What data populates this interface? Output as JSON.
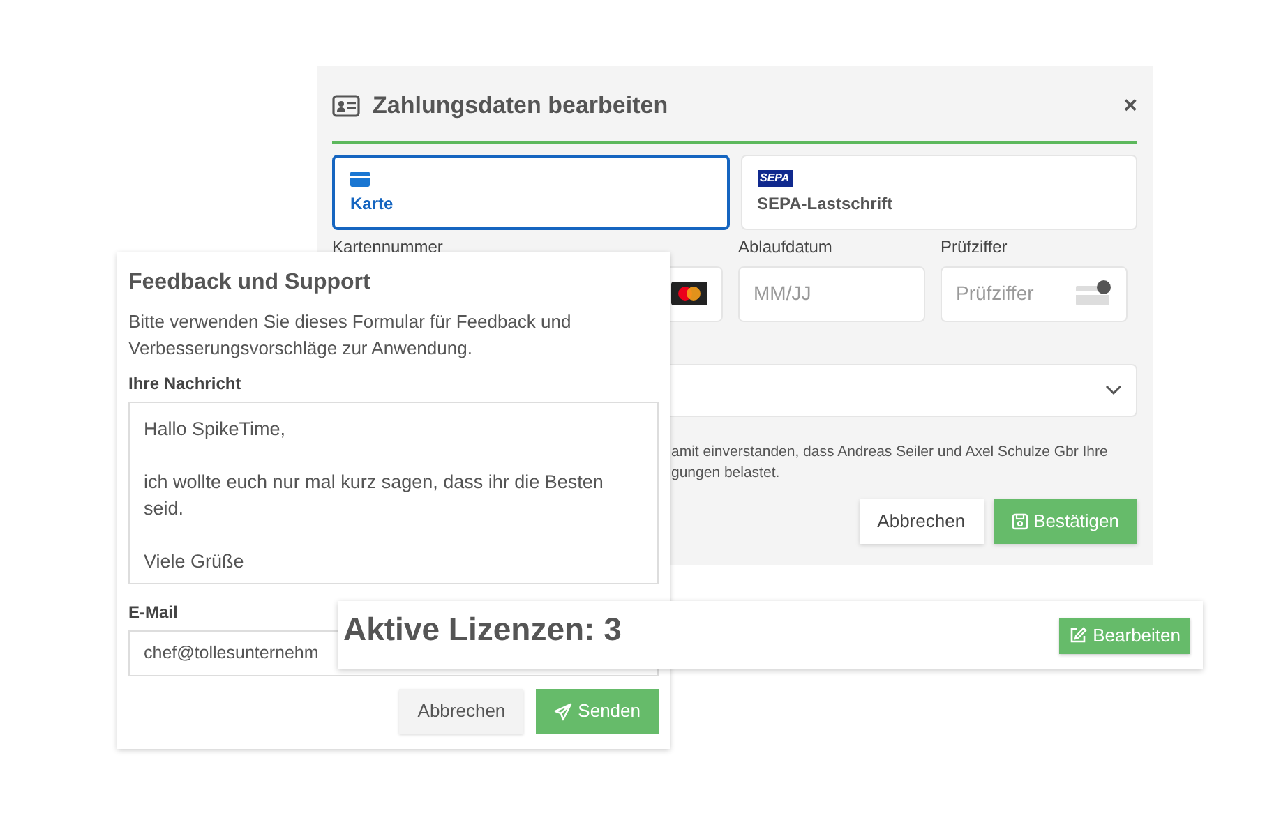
{
  "payment_dialog": {
    "title": "Zahlungsdaten bearbeiten",
    "close": "×",
    "methods": [
      {
        "label": "Karte",
        "kind": "card",
        "selected": true
      },
      {
        "label": "SEPA-Lastschrift",
        "kind": "sepa",
        "logo": "SEPA",
        "selected": false
      }
    ],
    "fields": [
      {
        "label": "Kartennummer",
        "kind": "card_number"
      },
      {
        "label": "Ablaufdatum",
        "placeholder": "MM/JJ",
        "kind": "text"
      },
      {
        "label": "Prüfziffer",
        "placeholder": "Prüfziffer",
        "kind": "cvc"
      }
    ],
    "mandate_text": [
      "amit einverstanden, dass Andreas Seiler und Axel Schulze Gbr Ihre",
      "gungen belastet."
    ],
    "buttons": [
      {
        "label": "Abbrechen",
        "kind": "secondary"
      },
      {
        "label": "Bestätigen",
        "kind": "primary"
      }
    ]
  },
  "feedback_card": {
    "title": "Feedback und Support",
    "description": "Bitte verwenden Sie dieses Formular für Feedback und Verbesserungsvorschläge zur Anwendung.",
    "message_label": "Ihre Nachricht",
    "message_paragraphs": [
      "Hallo SpikeTime,",
      "ich wollte euch nur mal kurz sagen, dass ihr die Besten seid.",
      "Viele Grüße"
    ],
    "email_label": "E-Mail",
    "email_value": "chef@tollesunternehm",
    "buttons": [
      {
        "label": "Abbrechen",
        "kind": "secondary"
      },
      {
        "label": "Senden",
        "kind": "primary"
      }
    ]
  },
  "license_card": {
    "title": "Aktive Lizenzen: 3",
    "button": "Bearbeiten"
  }
}
